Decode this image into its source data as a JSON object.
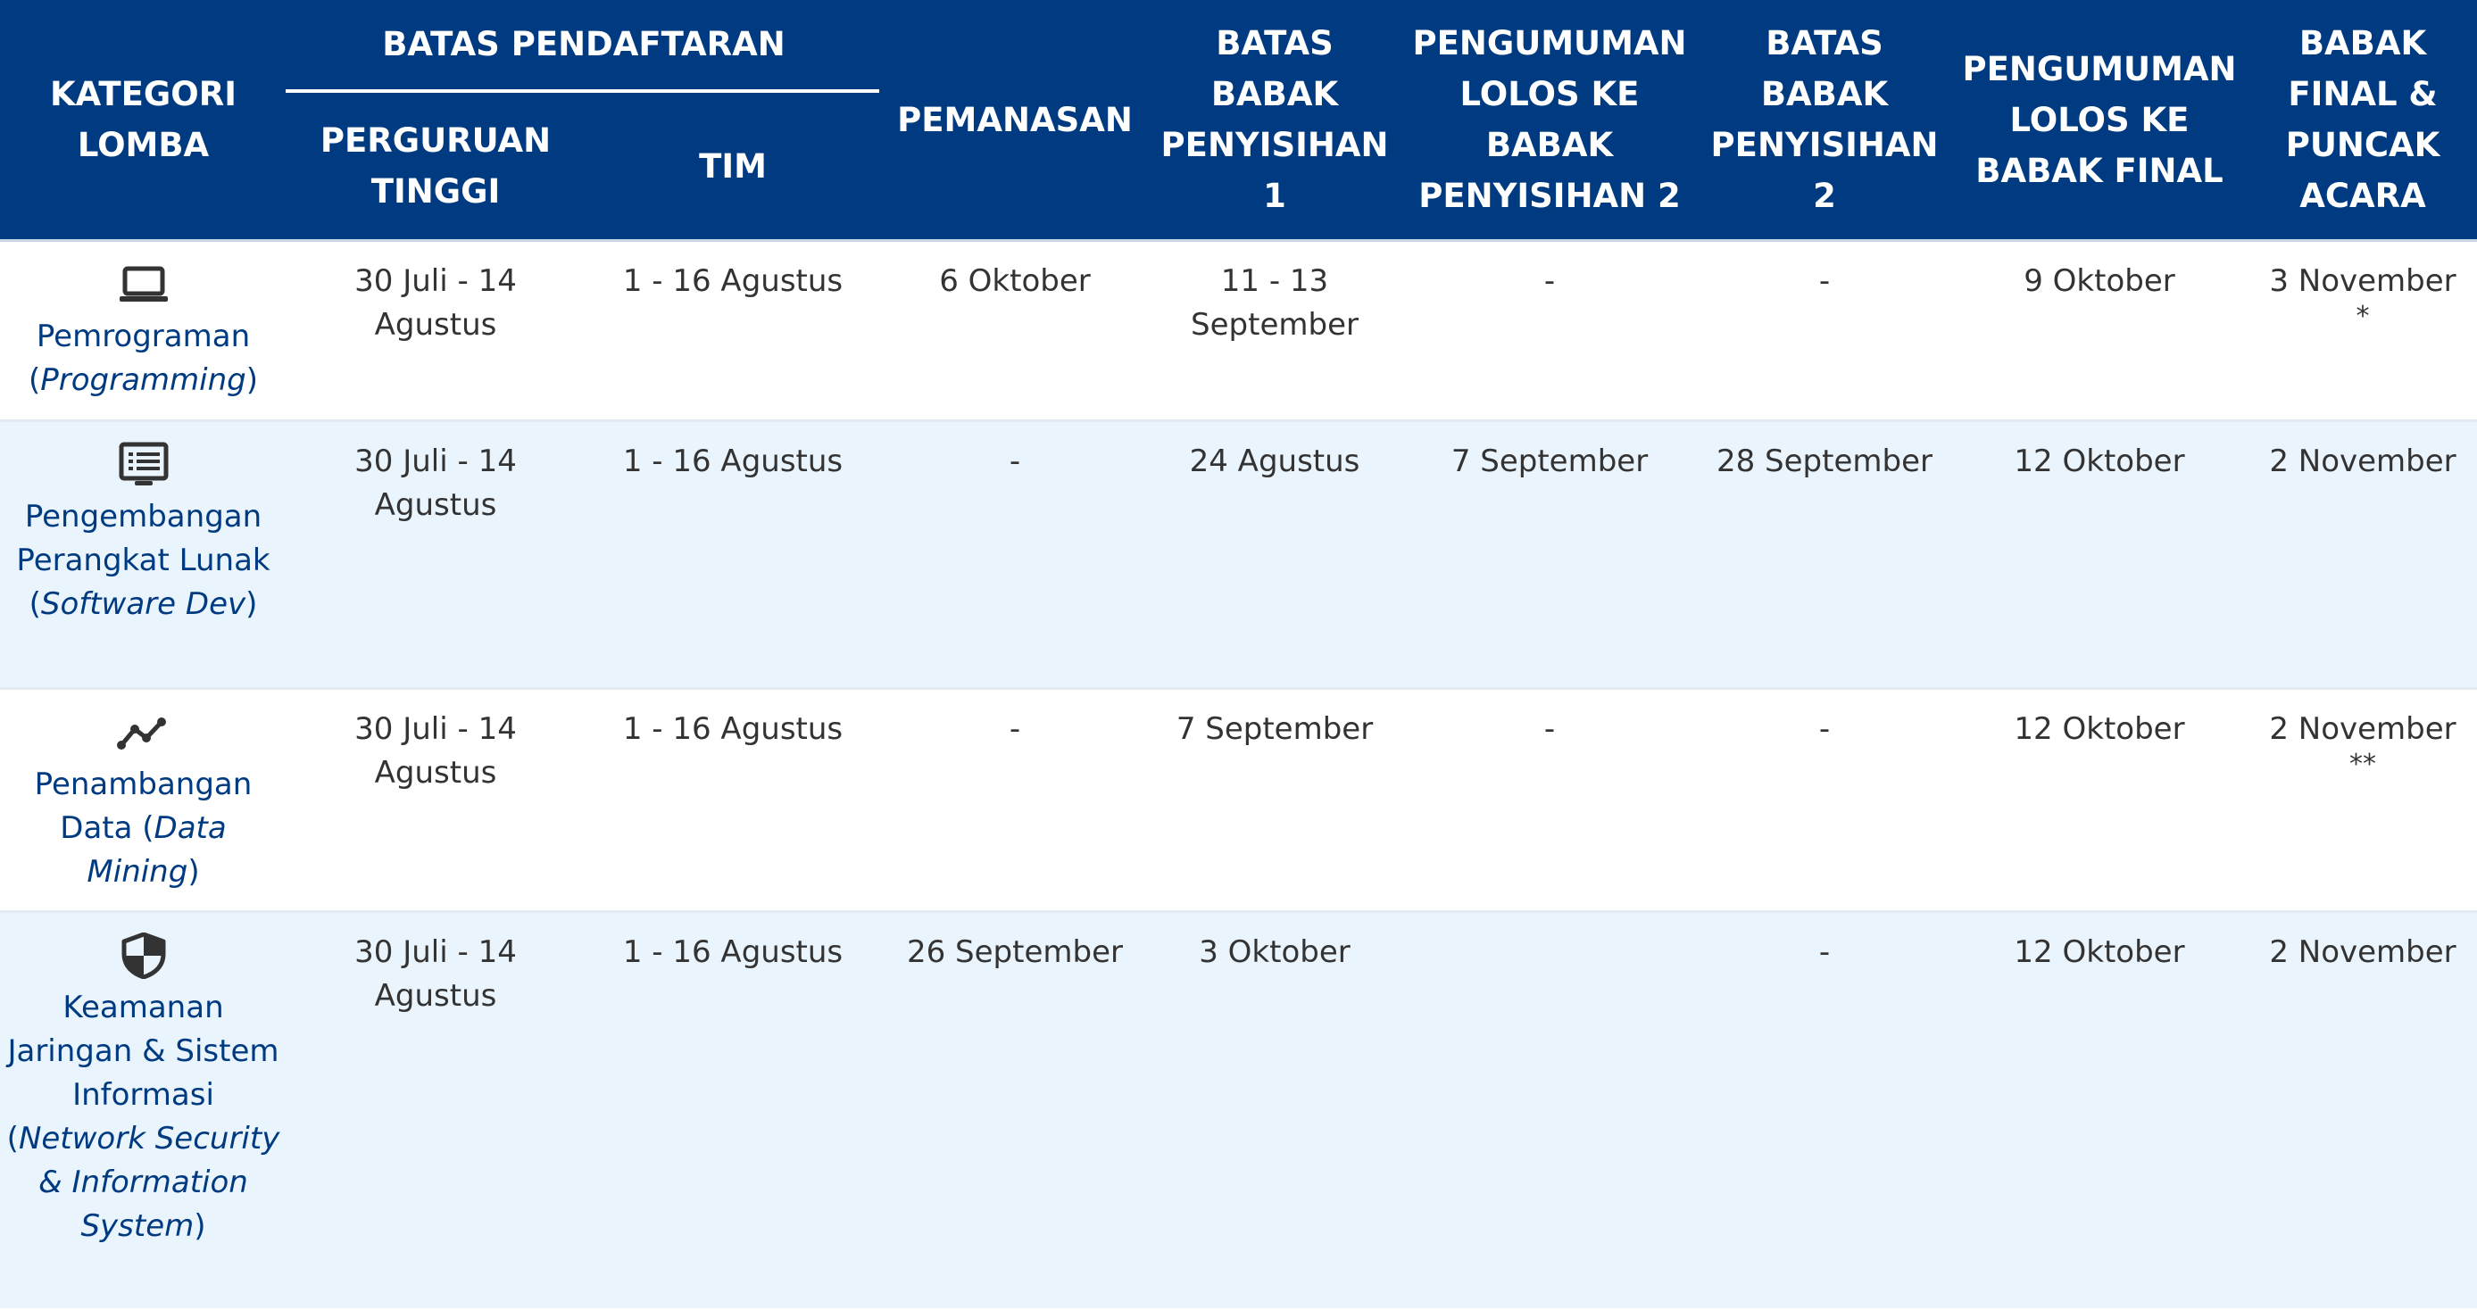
{
  "header": {
    "kategori": "KATEGORI LOMBA",
    "batas_pendaftaran": "BATAS PENDAFTARAN",
    "perguruan_tinggi": "PERGURUAN TINGGI",
    "tim": "TIM",
    "pemanasan": "PEMANASAN",
    "batas_penyisihan_1": "BATAS BABAK PENYISIHAN 1",
    "pengumuman_penyisihan_2": "PENGUMUMAN LOLOS KE BABAK PENYISIHAN 2",
    "batas_penyisihan_2": "BATAS BABAK PENYISIHAN 2",
    "pengumuman_final": "PENGUMUMAN LOLOS KE BABAK FINAL",
    "final_puncak": "BABAK FINAL & PUNCAK ACARA"
  },
  "rows": [
    {
      "icon": "laptop-icon",
      "category_id": "Pemrograman (",
      "category_en": "Programming",
      "category_close": ")",
      "perguruan_tinggi": "30 Juli - 14 Agustus",
      "tim": "1 - 16 Agustus",
      "pemanasan": "6 Oktober",
      "batas_penyisihan_1": "11 - 13 September",
      "pengumuman_penyisihan_2": "-",
      "batas_penyisihan_2": "-",
      "pengumuman_final": "9 Oktober",
      "final_puncak": "3 November",
      "final_note": "*"
    },
    {
      "icon": "monitor-list-icon",
      "category_id": "Pengembangan Perangkat Lunak (",
      "category_en": "Software Dev",
      "category_close": ")",
      "perguruan_tinggi": "30 Juli - 14 Agustus",
      "tim": "1 - 16 Agustus",
      "pemanasan": "-",
      "batas_penyisihan_1": "24 Agustus",
      "pengumuman_penyisihan_2": "7 September",
      "batas_penyisihan_2": "28 September",
      "pengumuman_final": "12 Oktober",
      "final_puncak": "2 November",
      "final_note": ""
    },
    {
      "icon": "line-chart-icon",
      "category_id": "Penambangan Data (",
      "category_en": "Data Mining",
      "category_close": ")",
      "perguruan_tinggi": "30 Juli - 14 Agustus",
      "tim": "1 - 16 Agustus",
      "pemanasan": "-",
      "batas_penyisihan_1": "7 September",
      "pengumuman_penyisihan_2": "-",
      "batas_penyisihan_2": "-",
      "pengumuman_final": "12 Oktober",
      "final_puncak": "2 November",
      "final_note": "**"
    },
    {
      "icon": "shield-icon",
      "category_id": "Keamanan Jaringan & Sistem Informasi (",
      "category_en": "Network Security & Information System",
      "category_close": ")",
      "perguruan_tinggi": "30 Juli - 14 Agustus",
      "tim": "1 - 16 Agustus",
      "pemanasan": "26 September",
      "batas_penyisihan_1": "3 Oktober",
      "pengumuman_penyisihan_2": "",
      "batas_penyisihan_2": "-",
      "pengumuman_final": "12 Oktober",
      "final_puncak": "2 November",
      "final_note": ""
    }
  ],
  "colors": {
    "header_bg": "#003A80",
    "header_text": "#ffffff",
    "category_text": "#003A80",
    "body_text": "#333333",
    "alt_row_bg": "#EAF4FC"
  }
}
